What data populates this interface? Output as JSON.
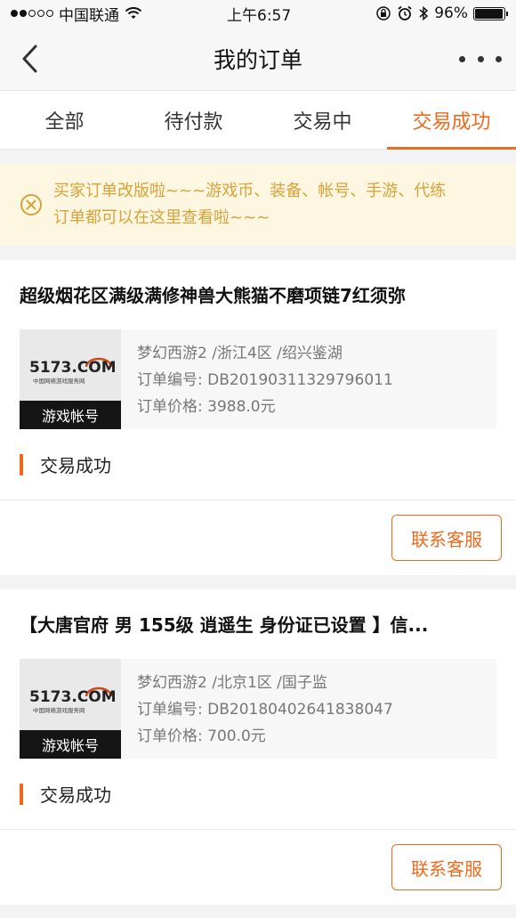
{
  "status_bar": {
    "carrier": "中国联通",
    "time": "上午6:57",
    "battery": "96%",
    "battery_level": 0.96,
    "signal_bars": 2
  },
  "navbar": {
    "title": "我的订单"
  },
  "tabs": [
    {
      "label": "全部",
      "active": false
    },
    {
      "label": "待付款",
      "active": false
    },
    {
      "label": "交易中",
      "active": false
    },
    {
      "label": "交易成功",
      "active": true
    }
  ],
  "notice": {
    "line1": "买家订单改版啦~~~游戏币、装备、帐号、手游、代练",
    "line2": "订单都可以在这里查看啦~~~"
  },
  "orders": [
    {
      "title": "超级烟花区满级满修神兽大熊猫不磨项链7红须弥",
      "logo_text": "5173.COM",
      "logo_sub": "中国网络游戏服务网",
      "badge": "游戏帐号",
      "server": "梦幻西游2 /浙江4区 /绍兴鉴湖",
      "order_no_label": "订单编号:",
      "order_no": "DB20190311329796011",
      "price_label": "订单价格:",
      "price": "3988.0元",
      "status": "交易成功",
      "action": "联系客服"
    },
    {
      "title": "【大唐官府 男 155级 逍遥生 身份证已设置 】信...",
      "logo_text": "5173.COM",
      "logo_sub": "中国网络游戏服务网",
      "badge": "游戏帐号",
      "server": "梦幻西游2 /北京1区 /国子监",
      "order_no_label": "订单编号:",
      "order_no": "DB20180402641838047",
      "price_label": "订单价格:",
      "price": "700.0元",
      "status": "交易成功",
      "action": "联系客服"
    }
  ],
  "colors": {
    "accent": "#ef6a1c",
    "notice_bg": "#fdf6e0",
    "notice_text": "#d7a23a"
  }
}
